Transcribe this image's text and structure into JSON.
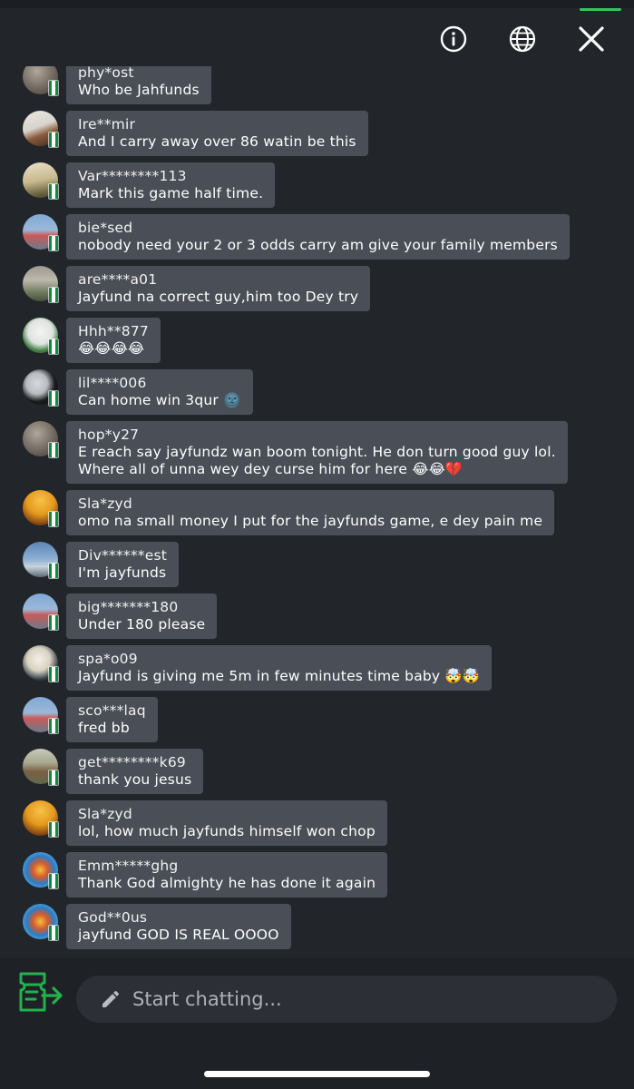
{
  "header": {
    "info_icon": "info-circle-icon",
    "globe_icon": "globe-icon",
    "close_icon": "close-icon",
    "accent_color": "#34c759"
  },
  "messages": [
    {
      "user": "phy*ost",
      "text": "Who be Jahfunds"
    },
    {
      "user": "Ire**mir",
      "text": "And I carry away over 86 watin be this"
    },
    {
      "user": "Var********113",
      "text": "Mark this game half time."
    },
    {
      "user": "bie*sed",
      "text": "nobody need your 2 or 3 odds carry am give your family members"
    },
    {
      "user": "are****a01",
      "text": "Jayfund na correct guy,him too Dey try"
    },
    {
      "user": "Hhh**877",
      "text": "😂😂😂😂"
    },
    {
      "user": "lil****006",
      "text": "Can home win 3qur 🌚"
    },
    {
      "user": "hop*y27",
      "text": "E reach say jayfundz wan boom tonight. He don turn good guy lol.",
      "text2": "Where all of unna wey dey curse him for here 😂😂💔"
    },
    {
      "user": "Sla*zyd",
      "text": "omo na small money I put for the jayfunds game, e dey pain me"
    },
    {
      "user": "Div******est",
      "text": "I'm jayfunds"
    },
    {
      "user": "big*******180",
      "text": "Under 180 please"
    },
    {
      "user": "spa*o09",
      "text": "Jayfund is giving me 5m in few minutes time baby 🤯🤯"
    },
    {
      "user": "sco***laq",
      "text": "fred bb"
    },
    {
      "user": "get********k69",
      "text": "thank you jesus"
    },
    {
      "user": "Sla*zyd",
      "text": "lol, how much jayfunds himself won chop"
    },
    {
      "user": "Emm*****ghg",
      "text": "Thank God almighty he has done it again"
    },
    {
      "user": "God**0us",
      "text": "jayfund GOD IS REAL OOOO"
    }
  ],
  "footer": {
    "gift_icon": "ticket-share-icon",
    "pencil_icon": "pencil-icon",
    "input_placeholder": "Start chatting...",
    "gift_color": "#22b14c"
  }
}
